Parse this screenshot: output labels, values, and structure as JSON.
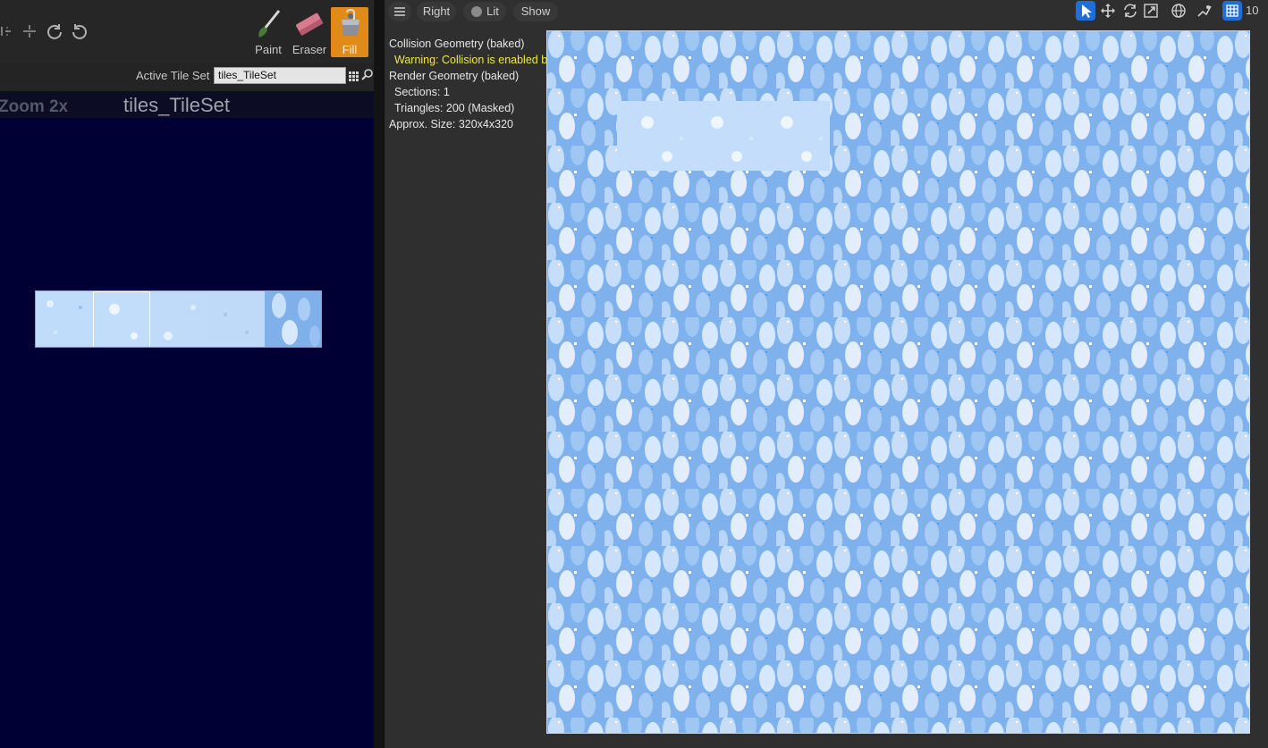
{
  "toolbar": {
    "tools": [
      {
        "label": "Paint"
      },
      {
        "label": "Eraser"
      },
      {
        "label": "Fill"
      }
    ],
    "selected_tool": "Fill",
    "active_tileset_label": "Active Tile Set",
    "active_tileset_value": "tiles_TileSet",
    "icons": [
      "rotate-left-icon",
      "flip-icon",
      "rotate-ccw-icon",
      "rotate-cw-icon",
      "grid-icon",
      "browse-icon"
    ]
  },
  "tile_view": {
    "zoom": "Zoom 2x",
    "title": "tiles_TileSet"
  },
  "viewport": {
    "menu_icon": "hamburger-icon",
    "view_mode": "Right",
    "lighting": "Lit",
    "show": "Show",
    "grid_snap_value": "10",
    "stats": {
      "collision": "Collision Geometry (baked)",
      "warning": "Warning: Collision is enabled but there are no shapes",
      "render": "Render Geometry (baked)",
      "sections": "Sections: 1",
      "triangles": "Triangles: 200 (Masked)",
      "size": "Approx. Size: 320x4x320"
    }
  },
  "colors": {
    "fill_accent": "#e08a1a",
    "tool_active": "#1f6fd8",
    "tile_view_bg": "#000034",
    "warning": "#f0e840"
  }
}
